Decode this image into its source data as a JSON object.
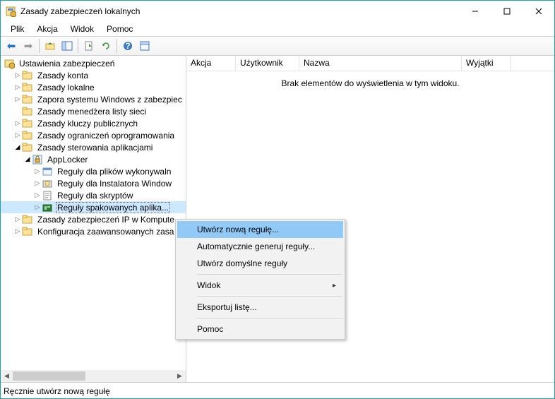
{
  "window": {
    "title": "Zasady zabezpieczeń lokalnych"
  },
  "menu": {
    "file": "Plik",
    "action": "Akcja",
    "view": "Widok",
    "help": "Pomoc"
  },
  "tree": {
    "root": "Ustawienia zabezpieczeń",
    "items": [
      "Zasady konta",
      "Zasady lokalne",
      "Zapora systemu Windows z zabezpiec",
      "Zasady menedżera listy sieci",
      "Zasady kluczy publicznych",
      "Zasady ograniczeń oprogramowania",
      "Zasady sterowania aplikacjami",
      "Zasady zabezpieczeń IP w Kompute",
      "Konfiguracja zaawansowanych zasa"
    ],
    "applocker": "AppLocker",
    "applocker_children": [
      "Reguły dla plików wykonywaln",
      "Reguły dla Instalatora Window",
      "Reguły dla skryptów",
      "Reguły spakowanych aplika..."
    ]
  },
  "list": {
    "columns": {
      "action": "Akcja",
      "user": "Użytkownik",
      "name": "Nazwa",
      "exceptions": "Wyjątki"
    },
    "empty": "Brak elementów do wyświetlenia w tym widoku."
  },
  "context": {
    "new_rule": "Utwórz nową regułę...",
    "auto_gen": "Automatycznie generuj reguły...",
    "default_rules": "Utwórz domyślne reguły",
    "view": "Widok",
    "export": "Eksportuj listę...",
    "help": "Pomoc"
  },
  "status": "Ręcznie utwórz nową regułę"
}
